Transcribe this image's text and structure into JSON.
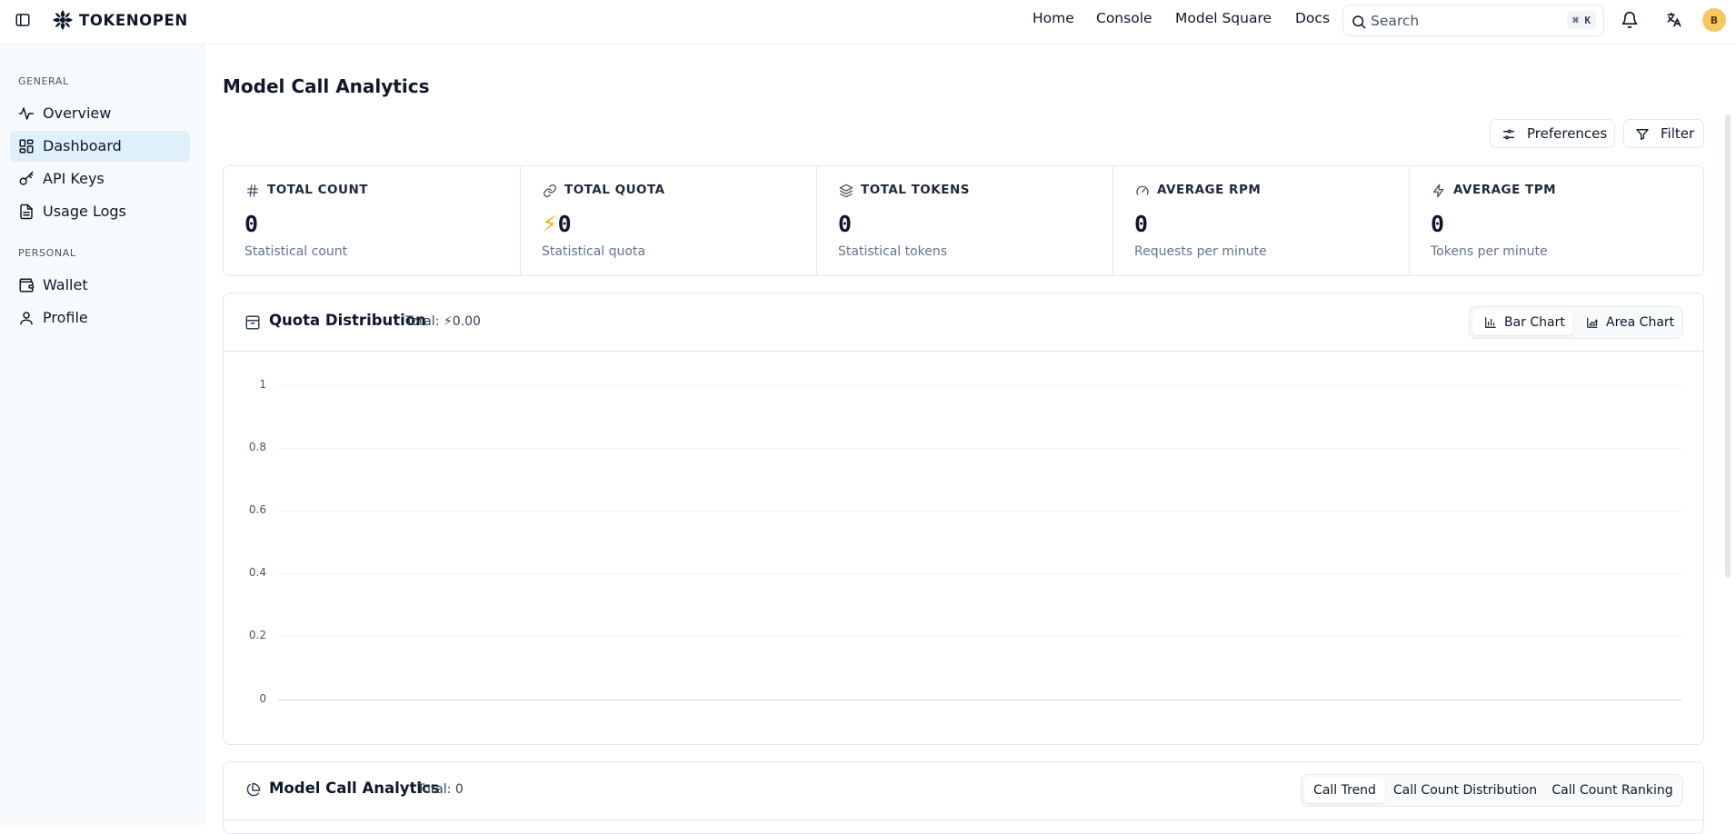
{
  "brand": {
    "name": "TOKENOPEN"
  },
  "nav": {
    "links": [
      "Home",
      "Console",
      "Model Square",
      "Docs"
    ],
    "search_placeholder": "Search",
    "search_shortcut": "⌘ K",
    "avatar_initial": "B"
  },
  "sidebar": {
    "general_label": "GENERAL",
    "personal_label": "PERSONAL",
    "general_items": [
      {
        "label": "Overview",
        "icon": "activity-icon"
      },
      {
        "label": "Dashboard",
        "icon": "dashboard-icon",
        "active": true
      },
      {
        "label": "API Keys",
        "icon": "key-icon"
      },
      {
        "label": "Usage Logs",
        "icon": "file-text-icon"
      }
    ],
    "personal_items": [
      {
        "label": "Wallet",
        "icon": "wallet-icon"
      },
      {
        "label": "Profile",
        "icon": "user-icon"
      }
    ]
  },
  "page": {
    "title": "Model Call Analytics",
    "preferences_label": "Preferences",
    "filter_label": "Filter"
  },
  "stats": [
    {
      "label": "TOTAL COUNT",
      "value": "0",
      "sub": "Statistical count",
      "icon": "hash-icon"
    },
    {
      "label": "TOTAL QUOTA",
      "value": "0",
      "prefix": "⚡",
      "sub": "Statistical quota",
      "icon": "link-icon"
    },
    {
      "label": "TOTAL TOKENS",
      "value": "0",
      "sub": "Statistical tokens",
      "icon": "layers-icon"
    },
    {
      "label": "AVERAGE RPM",
      "value": "0",
      "sub": "Requests per minute",
      "icon": "gauge-icon"
    },
    {
      "label": "AVERAGE TPM",
      "value": "0",
      "sub": "Tokens per minute",
      "icon": "zap-icon"
    }
  ],
  "quota_card": {
    "title": "Quota Distribution",
    "total_prefix": "Total: ",
    "total_value": "⚡0.00",
    "bar_chart_label": "Bar Chart",
    "area_chart_label": "Area Chart"
  },
  "analytics_card": {
    "title": "Model Call Analytics",
    "total": "Total: 0",
    "tabs": [
      "Call Trend",
      "Call Count Distribution",
      "Call Count Ranking"
    ]
  },
  "chart_data": {
    "type": "bar",
    "title": "Quota Distribution",
    "categories": [],
    "values": [],
    "ylim": [
      0,
      1
    ],
    "yticks": [
      "1",
      "0.8",
      "0.6",
      "0.4",
      "0.2",
      "0"
    ],
    "grid": true
  },
  "colors": {
    "accent": "#e0f0fb",
    "bolt": "#f5b400",
    "avatar": "#f6c85f"
  }
}
